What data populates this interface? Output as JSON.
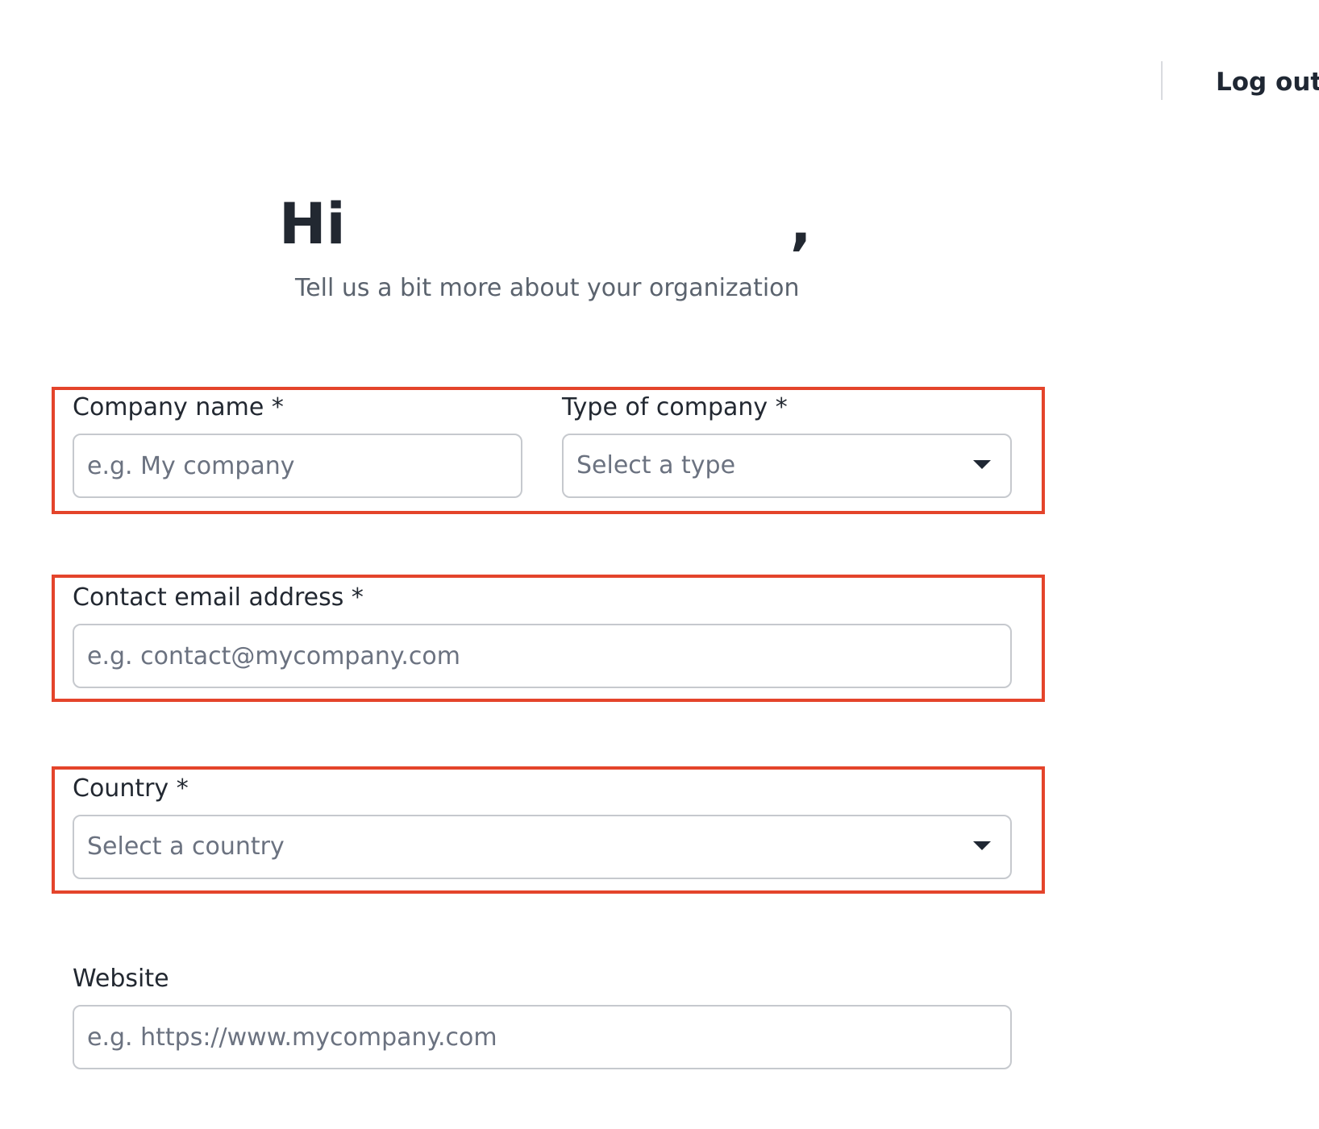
{
  "header": {
    "logout_label": "Log out"
  },
  "greeting": {
    "hi": "Hi",
    "comma": ",",
    "subtitle": "Tell us a bit more about your organization"
  },
  "form": {
    "company_name": {
      "label": "Company name *",
      "placeholder": "e.g. My company"
    },
    "company_type": {
      "label": "Type of company *",
      "selected": "Select a type"
    },
    "contact_email": {
      "label": "Contact email address *",
      "placeholder": "e.g. contact@mycompany.com"
    },
    "country": {
      "label": "Country *",
      "selected": "Select a country"
    },
    "website": {
      "label": "Website",
      "placeholder": "e.g. https://www.mycompany.com"
    }
  },
  "colors": {
    "highlight": "#e4442b",
    "field_border": "#c6c9ce",
    "placeholder": "#6b7280",
    "text": "#222831"
  },
  "icons": [
    "chevron-down-icon"
  ]
}
